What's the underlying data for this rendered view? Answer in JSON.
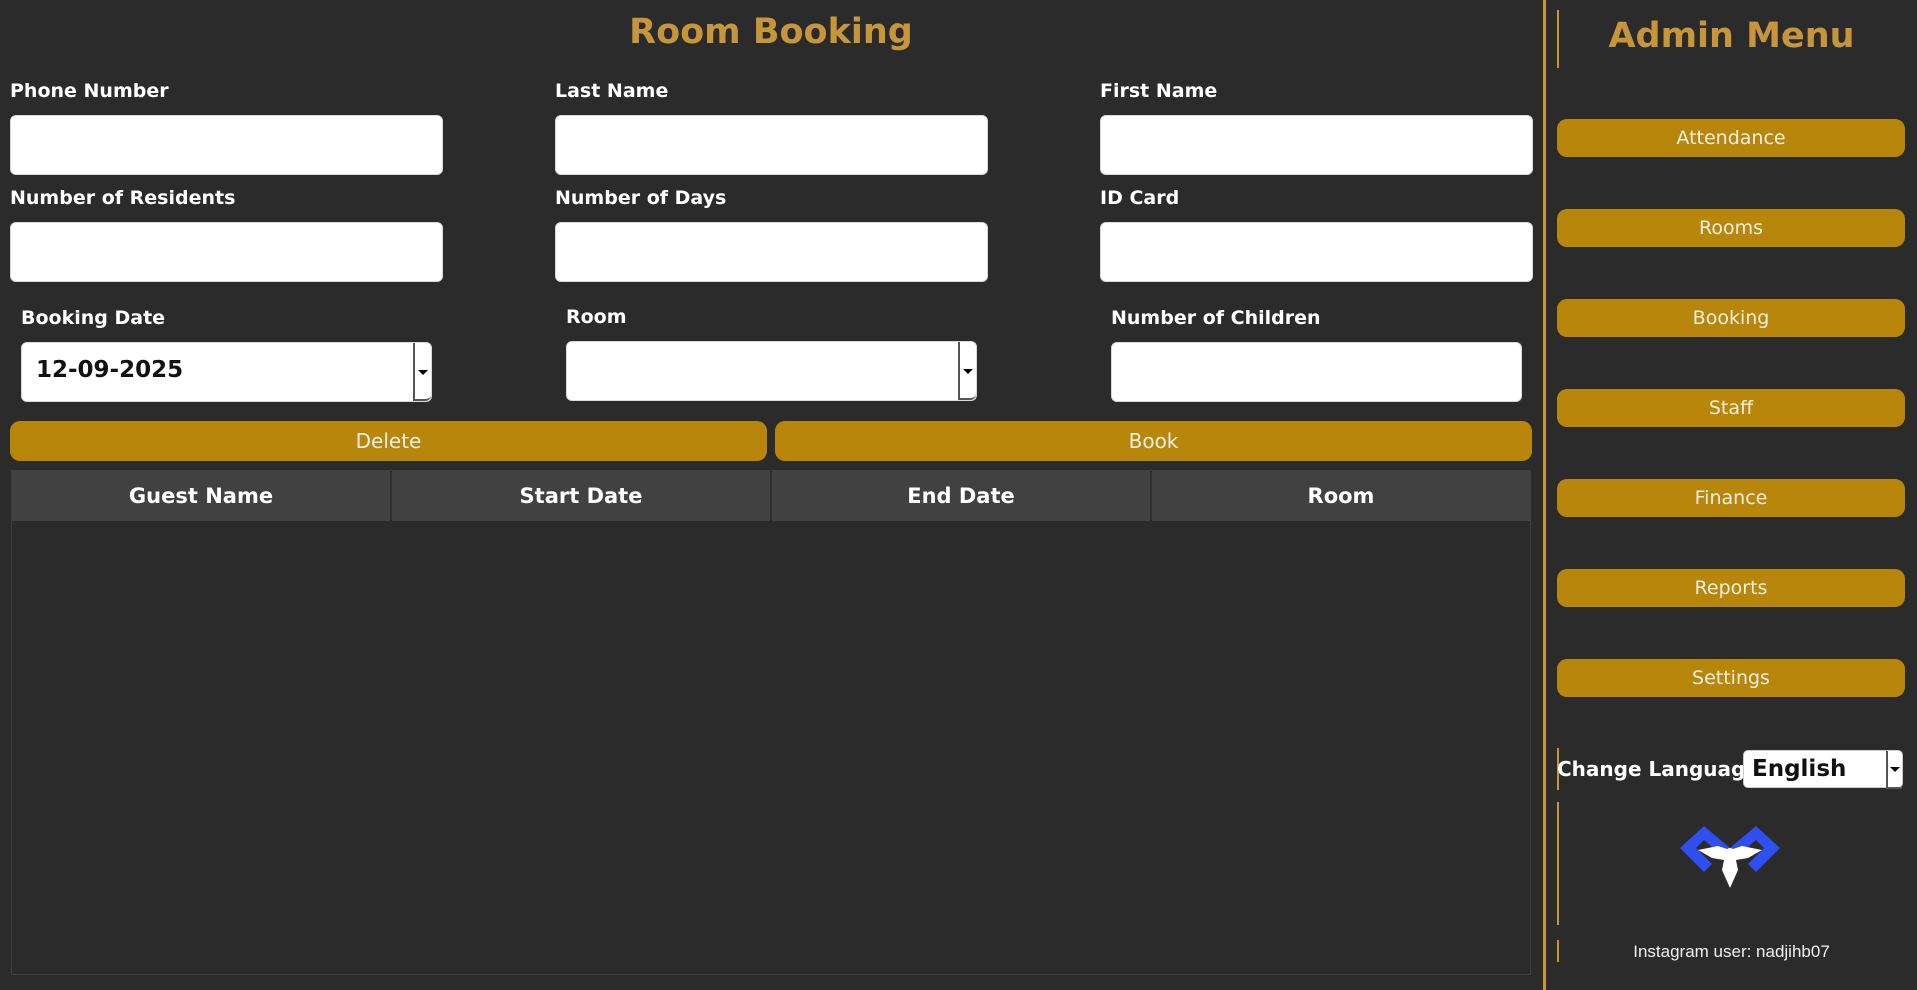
{
  "main": {
    "title": "Room Booking",
    "fields": {
      "phone_number": {
        "label": "Phone Number",
        "value": ""
      },
      "last_name": {
        "label": "Last Name",
        "value": ""
      },
      "first_name": {
        "label": "First Name",
        "value": ""
      },
      "number_of_residents": {
        "label": "Number of Residents",
        "value": ""
      },
      "number_of_days": {
        "label": "Number of Days",
        "value": ""
      },
      "id_card": {
        "label": "ID Card",
        "value": ""
      },
      "booking_date": {
        "label": "Booking Date",
        "value": "12-09-2025"
      },
      "room": {
        "label": "Room",
        "value": ""
      },
      "number_of_children": {
        "label": "Number of Children",
        "value": ""
      }
    },
    "buttons": {
      "delete": "Delete",
      "book": "Book"
    },
    "table": {
      "columns": [
        "Guest Name",
        "Start Date",
        "End Date",
        "Room"
      ],
      "rows": []
    }
  },
  "sidebar": {
    "title": "Admin Menu",
    "items": [
      {
        "label": "Attendance"
      },
      {
        "label": "Rooms"
      },
      {
        "label": "Booking"
      },
      {
        "label": "Staff"
      },
      {
        "label": "Finance"
      },
      {
        "label": "Reports"
      },
      {
        "label": "Settings"
      }
    ],
    "language": {
      "label": "Change Language",
      "selected": "English"
    },
    "footer": "Instagram user: nadjihb07"
  },
  "colors": {
    "background": "#2b2b2b",
    "accent": "#c8963a",
    "button": "#b8860b",
    "logo_blue": "#2f4ff0"
  }
}
